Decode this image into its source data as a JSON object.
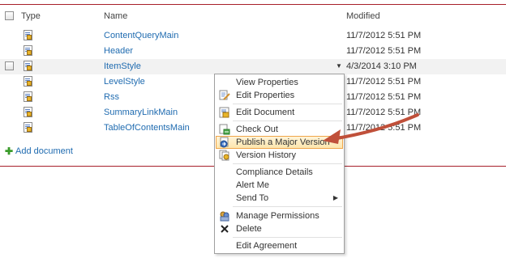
{
  "header": {
    "type_label": "Type",
    "name_label": "Name",
    "modified_label": "Modified"
  },
  "rows": [
    {
      "name": "ContentQueryMain",
      "modified": "11/7/2012 5:51 PM"
    },
    {
      "name": "Header",
      "modified": "11/7/2012 5:51 PM"
    },
    {
      "name": "ItemStyle",
      "modified": "4/3/2014 3:10 PM"
    },
    {
      "name": "LevelStyle",
      "modified": "11/7/2012 5:51 PM"
    },
    {
      "name": "Rss",
      "modified": "11/7/2012 5:51 PM"
    },
    {
      "name": "SummaryLinkMain",
      "modified": "11/7/2012 5:51 PM"
    },
    {
      "name": "TableOfContentsMain",
      "modified": "11/7/2012 5:51 PM"
    }
  ],
  "add_document": "Add document",
  "context_menu": {
    "items": [
      {
        "label": "View Properties",
        "icon": "none"
      },
      {
        "label": "Edit Properties",
        "icon": "edit-properties-icon"
      },
      {
        "label": "Edit Document",
        "icon": "word-doc-icon"
      },
      {
        "label": "Check Out",
        "icon": "check-out-icon"
      },
      {
        "label": "Publish a Major Version",
        "icon": "publish-icon"
      },
      {
        "label": "Version History",
        "icon": "version-history-icon"
      },
      {
        "label": "Compliance Details",
        "icon": "none"
      },
      {
        "label": "Alert Me",
        "icon": "none"
      },
      {
        "label": "Send To",
        "icon": "none"
      },
      {
        "label": "Manage Permissions",
        "icon": "permissions-icon"
      },
      {
        "label": "Delete",
        "icon": "delete-x-icon"
      },
      {
        "label": "Edit Agreement",
        "icon": "none"
      }
    ],
    "highlighted_item": "Publish a Major Version"
  },
  "colors": {
    "link": "#1f6bb0",
    "rule": "#a7202a",
    "highlight_border": "#f0a64a",
    "annotation_arrow": "#c0503a"
  }
}
